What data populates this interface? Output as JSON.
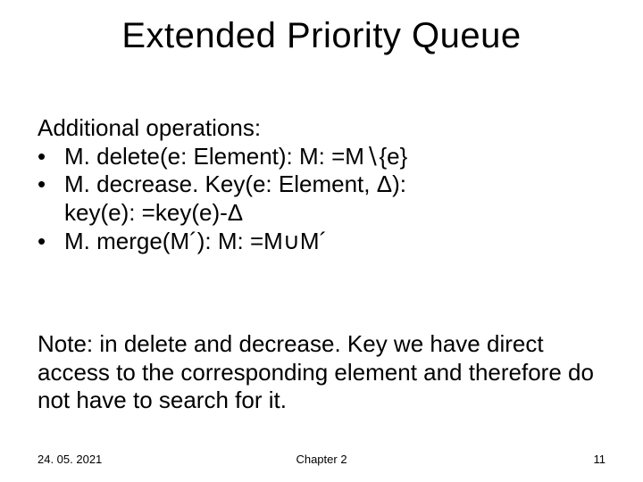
{
  "title": "Extended Priority Queue",
  "heading": "Additional operations:",
  "bullets": [
    {
      "dot": "•",
      "text": "M. delete(e: Element): M: =M∖{e}"
    },
    {
      "dot": "•",
      "text": "M. decrease. Key(e: Element, Δ):"
    },
    {
      "dot": "",
      "text": "key(e): =key(e)-Δ"
    },
    {
      "dot": "•",
      "text": "M. merge(M´): M: =M∪M´"
    }
  ],
  "note": "Note: in delete and decrease. Key we have direct access to the corresponding element and therefore do not have to search for it.",
  "footer": {
    "date": "24. 05. 2021",
    "chapter": "Chapter 2",
    "page": "11"
  }
}
